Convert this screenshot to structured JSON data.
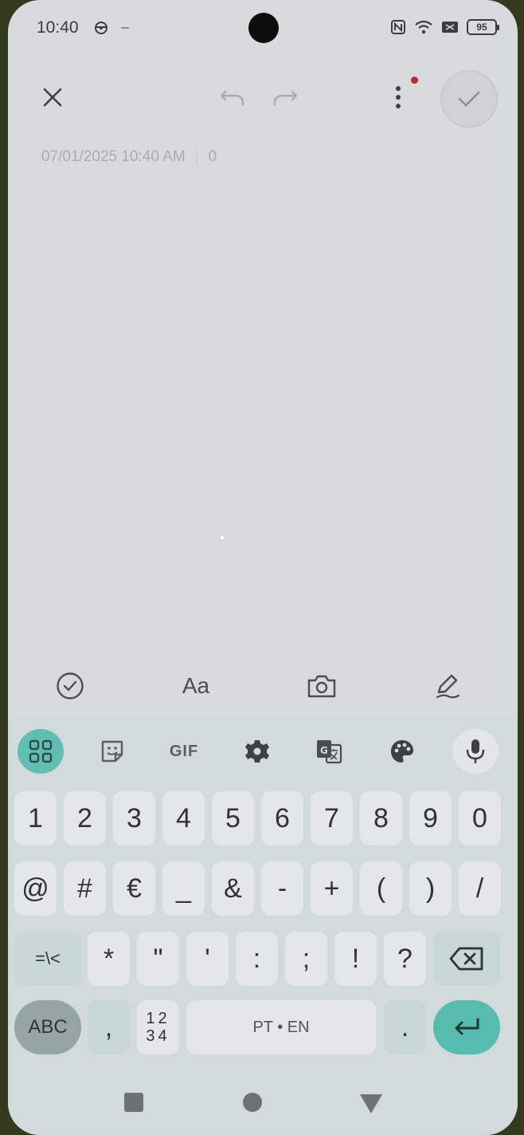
{
  "status_bar": {
    "time": "10:40",
    "battery": "95",
    "icons": [
      "steering-icon",
      "nfc-icon",
      "wifi-icon",
      "sim-icon",
      "battery-icon"
    ]
  },
  "top_bar": {
    "icons": [
      "close-icon",
      "undo-icon",
      "redo-icon",
      "more-vert-icon",
      "check-icon"
    ],
    "notification_dot_color": "#c0282b"
  },
  "note": {
    "datetime": "07/01/2025 10:40 AM",
    "char_count": "0"
  },
  "note_toolbar": {
    "checklist_icon": "check-circle-icon",
    "text_style_label": "Aa",
    "camera_icon": "camera-icon",
    "draw_icon": "pen-icon"
  },
  "keyboard": {
    "toolbar": [
      "apps-grid-icon",
      "sticker-icon",
      "GIF",
      "gear-icon",
      "translate-icon",
      "palette-icon",
      "mic-icon"
    ],
    "gif_label": "GIF",
    "accent_color": "#56bcae",
    "row1": [
      "1",
      "2",
      "3",
      "4",
      "5",
      "6",
      "7",
      "8",
      "9",
      "0"
    ],
    "row2": [
      "@",
      "#",
      "€",
      "_",
      "&",
      "-",
      "+",
      "(",
      ")",
      "/"
    ],
    "row3": [
      "=\\<",
      "*",
      "\"",
      "'",
      ":",
      ";",
      "!",
      "?"
    ],
    "row4": {
      "abc": "ABC",
      "comma": ",",
      "nums_top": "12",
      "nums_bottom": "34",
      "space": "PT • EN",
      "period": "."
    }
  },
  "nav_bar": {
    "icons": [
      "recents-square-icon",
      "home-circle-icon",
      "back-triangle-icon"
    ]
  }
}
